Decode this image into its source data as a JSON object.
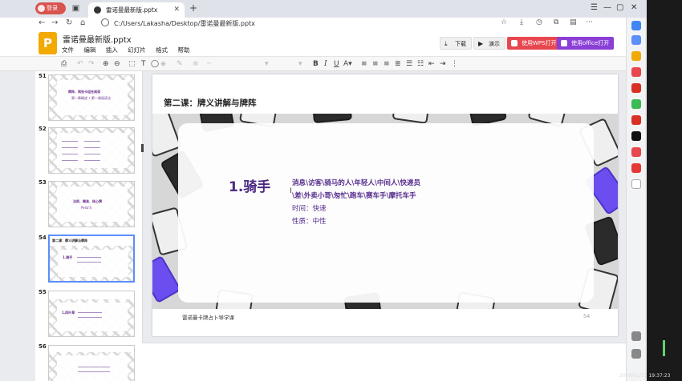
{
  "browser": {
    "login_label": "登录",
    "tab_title": "雷诺曼最新版.pptx",
    "address": "C:/Users/Lakasha/Desktop/雷诺曼最新版.pptx"
  },
  "app": {
    "logo_letter": "P",
    "file_title": "雷诺曼最新版.pptx",
    "menu": [
      "文件",
      "编辑",
      "插入",
      "幻灯片",
      "格式",
      "帮助"
    ],
    "buttons": {
      "download": "下载",
      "present": "演示",
      "open_wps": "使用WPS打开",
      "open_office": "使用office打开"
    },
    "colors": {
      "wps": "#e8474f",
      "office": "#8a3fd6",
      "accent": "#552c8c"
    }
  },
  "thumbnails": [
    {
      "number": "51",
      "title": "牌阵、两张卡组合阅读",
      "sub": "第一章概述 • 第一课阅读法"
    },
    {
      "number": "52",
      "title": "",
      "sub": ""
    },
    {
      "number": "53",
      "title": "法则、精准、核心牌",
      "sub": "Pelia'S"
    },
    {
      "number": "54",
      "title": "第二课：牌义讲解与牌阵",
      "sub": "1.骑手"
    },
    {
      "number": "55",
      "title": "1.四叶草",
      "sub": ""
    },
    {
      "number": "56",
      "title": "",
      "sub": ""
    }
  ],
  "slide": {
    "title": "第二课：牌义讲解与牌阵",
    "heading": "1.骑手",
    "keywords_line1": "消息\\访客\\骑马的人\\年轻人\\中间人\\快递员",
    "keywords_line2": "\\差\\外卖小哥\\匆忙\\跑车\\赛车手\\摩托车手",
    "time": "时间：快速",
    "nature": "性质：中性",
    "footer": "雷诺曼卡牌占卜导学课",
    "page_number": "54"
  },
  "system": {
    "clock": "2020/01/23 19:37:23"
  }
}
